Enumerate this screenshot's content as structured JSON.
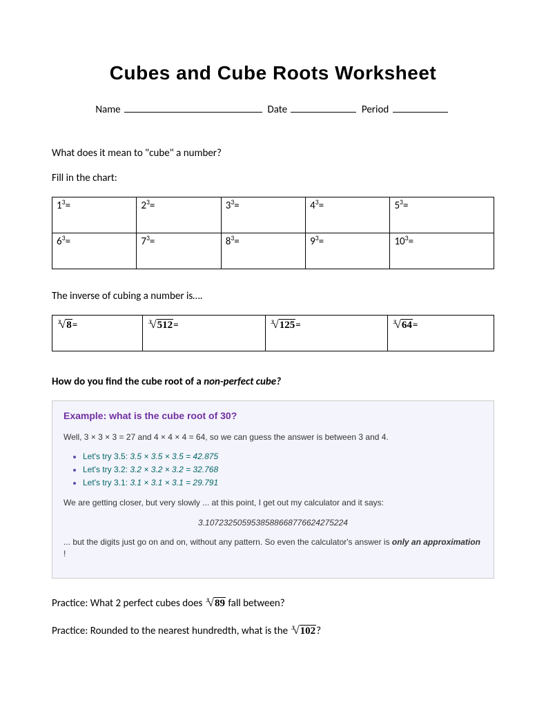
{
  "title": "Cubes and Cube Roots Worksheet",
  "header": {
    "name_label": "Name",
    "date_label": "Date",
    "period_label": "Period"
  },
  "q1": "What does it mean to \"cube\" a number?",
  "fill_label": "Fill in the chart:",
  "cubes": [
    "1",
    "2",
    "3",
    "4",
    "5",
    "6",
    "7",
    "8",
    "9",
    "10"
  ],
  "inverse_text": "The inverse of cubing a number is….",
  "roots": [
    "8",
    "512",
    "125",
    "64"
  ],
  "nonperfect_q": "How do you find the cube root of a ",
  "nonperfect_em": "non-perfect cube?",
  "example": {
    "title": "Example: what is the cube root of 30?",
    "line1": "Well, 3 × 3 × 3 = 27 and 4 × 4 × 4 = 64, so we can guess the answer is between 3 and 4.",
    "trials": [
      {
        "label": "Let's try 3.5:",
        "calc": "3.5 × 3.5 × 3.5 = 42.875"
      },
      {
        "label": "Let's try 3.2:",
        "calc": "3.2 × 3.2 × 3.2 = 32.768"
      },
      {
        "label": "Let's try 3.1:",
        "calc": "3.1 × 3.1 × 3.1 = 29.791"
      }
    ],
    "closer": "We are getting closer, but very slowly ... at this point, I get out my calculator and it says:",
    "value": "3.1072325059538588668776624275224",
    "final_a": "... but the digits just go on and on, without any pattern. So even the calculator's answer is ",
    "final_b": "only an approximation",
    "final_c": " !"
  },
  "practice1_a": "Practice: What 2 perfect cubes does ",
  "practice1_arg": "89",
  "practice1_b": " fall between?",
  "practice2_a": "Practice: Rounded to the nearest hundredth, what is the ",
  "practice2_arg": "102",
  "practice2_b": "?"
}
